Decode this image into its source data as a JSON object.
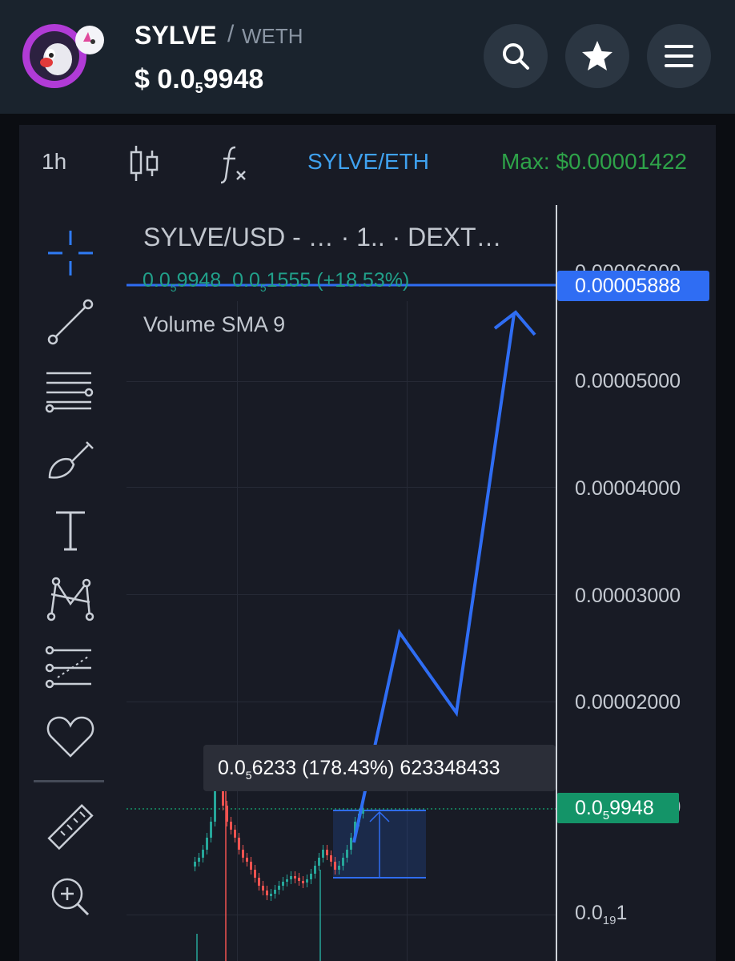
{
  "header": {
    "token": "SYLVE",
    "separator": "/",
    "quote": "WETH",
    "price_symbol": "$",
    "price_prefix": "0.0",
    "price_zeros": "5",
    "price_digits": "9948"
  },
  "toolbar": {
    "timeframe": "1h",
    "pair_label": "SYLVE/ETH",
    "max_label": "Max: $0.00001422"
  },
  "legend": {
    "title": "SYLVE/USD - … · 1.. · DEXT…",
    "ohlc_prefix": "0.0",
    "ohlc_zeros": "5",
    "ohlc_digits": "9948",
    "ohlc2_prefix": "0.0",
    "ohlc2_zeros": "5",
    "ohlc2_digits": "1555",
    "ohlc_change": "(+18.53%)",
    "volume_label": "Volume SMA 9"
  },
  "axis": {
    "top_cut": "0.00006000",
    "drawn_line": "0.00005888",
    "l5000": "0.00005000",
    "l4000": "0.00004000",
    "l3000": "0.00003000",
    "l2000": "0.00002000",
    "cur_suffix": ")0",
    "bottom_prefix": "0.0",
    "bottom_zeros": "19",
    "bottom_digit": "1"
  },
  "current_price_tag": {
    "prefix": "0.0",
    "zeros": "5",
    "digits": "9948"
  },
  "measure_tooltip": {
    "prefix": "0.0",
    "zeros": "5",
    "rest": "6233 (178.43%) 623348433"
  },
  "colors": {
    "accent_blue": "#2f6df3",
    "green": "#149468",
    "max_green": "#2ea349",
    "link_blue": "#3fa2f0",
    "up_candle": "#26a69a",
    "down_candle": "#ef5350"
  },
  "icons": {
    "search": "search-icon",
    "favorite": "star-icon",
    "menu": "menu-icon",
    "candles": "candlestick-icon",
    "indicators": "function-icon",
    "crosshair": "crosshair-icon",
    "trend_line": "trend-line-icon",
    "fib": "fib-levels-icon",
    "brush": "brush-icon",
    "text": "text-icon",
    "patterns": "pattern-icon",
    "prediction": "prediction-icon",
    "favorites": "heart-icon",
    "ruler": "ruler-icon",
    "zoom": "zoom-in-icon"
  }
}
